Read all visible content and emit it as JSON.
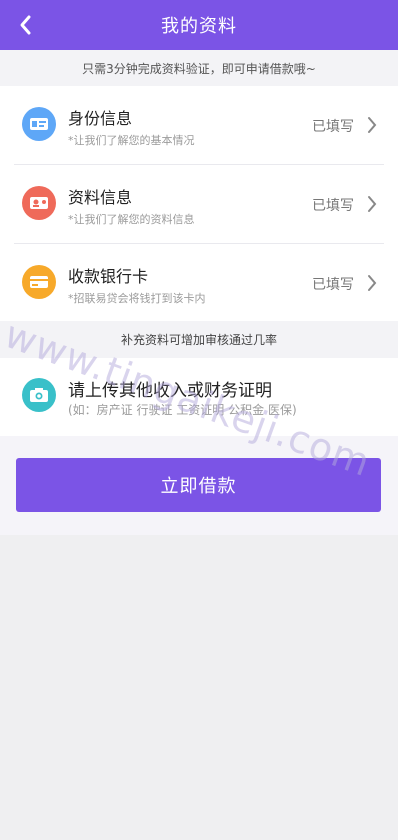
{
  "header": {
    "title": "我的资料",
    "back_icon": "chevron-left-icon"
  },
  "tip": "只需3分钟完成资料验证，即可申请借款哦~",
  "items": [
    {
      "label": "身份信息",
      "sub": "*让我们了解您的基本情况",
      "status": "已填写",
      "icon": "id-card-icon",
      "color": "#5ea7f7"
    },
    {
      "label": "资料信息",
      "sub": "*让我们了解您的资料信息",
      "status": "已填写",
      "icon": "profile-icon",
      "color": "#ef6a5a"
    },
    {
      "label": "收款银行卡",
      "sub": "*招联易贷会将钱打到该卡内",
      "status": "已填写",
      "icon": "bank-card-icon",
      "color": "#f7a92a"
    }
  ],
  "section_note": "补充资料可增加审核通过几率",
  "upload": {
    "label": "请上传其他收入或财务证明",
    "sub": "(如：房产证 行驶证 工资证明 公积金 医保)",
    "icon": "camera-icon",
    "color": "#39c0c9"
  },
  "borrow_button": "立即借款",
  "watermark": "www.tingaikeji.com",
  "colors": {
    "accent": "#7b54e6"
  }
}
